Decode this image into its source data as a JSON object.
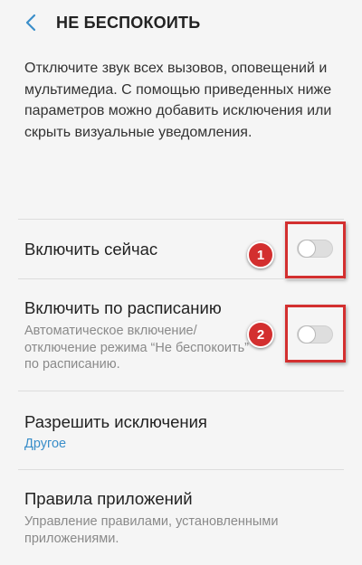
{
  "header": {
    "title": "НЕ БЕСПОКОИТЬ",
    "back_icon": "chevron-left-icon"
  },
  "description": "Отключите звук всех вызовов, оповещений и мультимедиа. С помощью приведенных ниже параметров можно добавить исключения или скрыть визуальные уведомления.",
  "settings": {
    "enable_now": {
      "label": "Включить сейчас",
      "enabled": false,
      "badge": "1"
    },
    "schedule": {
      "label": "Включить по расписанию",
      "subtitle": "Автоматическое включение/ отключение режима “Не беспокоить” по расписанию.",
      "enabled": false,
      "badge": "2"
    },
    "exceptions": {
      "label": "Разрешить исключения",
      "value": "Другое"
    },
    "app_rules": {
      "label": "Правила приложений",
      "subtitle": "Управление правилами, установленными приложениями."
    }
  },
  "colors": {
    "accent": "#3a8ec9",
    "highlight": "#d32f2f",
    "background": "#f5f5f5"
  }
}
